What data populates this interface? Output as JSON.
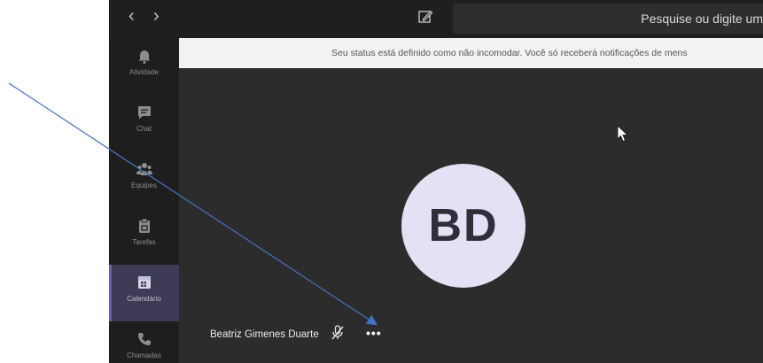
{
  "topbar": {
    "back_icon": "chevron-left-icon",
    "forward_icon": "chevron-right-icon",
    "compose_icon": "compose-icon",
    "search_text": "Pesquise ou digite um"
  },
  "banner": {
    "text": "Seu status está definido como não incomodar. Você só receberá notificações de mens"
  },
  "rail": {
    "items": [
      {
        "label": "Atividade",
        "icon": "bell-icon"
      },
      {
        "label": "Chat",
        "icon": "chat-icon"
      },
      {
        "label": "Equipes",
        "icon": "teams-icon"
      },
      {
        "label": "Tarefas",
        "icon": "tasks-icon"
      },
      {
        "label": "Calendário",
        "icon": "calendar-icon",
        "active": true
      },
      {
        "label": "Chamadas",
        "icon": "phone-icon"
      }
    ]
  },
  "call": {
    "avatar_initials": "BD",
    "participant_name": "Beatriz Gimenes Duarte",
    "mic_icon": "mic-off-icon",
    "more_label": "•••"
  },
  "colors": {
    "app_bg": "#2d2c2c",
    "rail_bg": "#1f1e1e",
    "accent": "#6264a7",
    "avatar_bg": "#e3e2f4",
    "annotation": "#4472c4"
  }
}
